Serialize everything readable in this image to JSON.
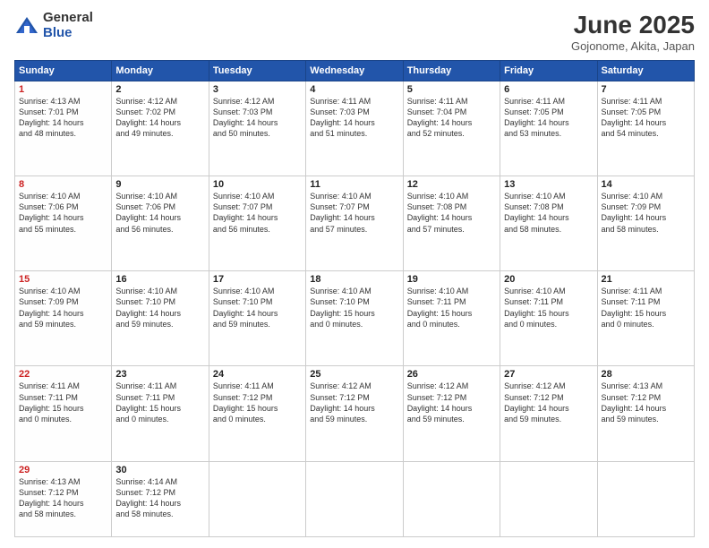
{
  "header": {
    "logo_general": "General",
    "logo_blue": "Blue",
    "month_title": "June 2025",
    "location": "Gojonome, Akita, Japan"
  },
  "weekdays": [
    "Sunday",
    "Monday",
    "Tuesday",
    "Wednesday",
    "Thursday",
    "Friday",
    "Saturday"
  ],
  "weeks": [
    [
      {
        "day": "1",
        "info": "Sunrise: 4:13 AM\nSunset: 7:01 PM\nDaylight: 14 hours\nand 48 minutes."
      },
      {
        "day": "2",
        "info": "Sunrise: 4:12 AM\nSunset: 7:02 PM\nDaylight: 14 hours\nand 49 minutes."
      },
      {
        "day": "3",
        "info": "Sunrise: 4:12 AM\nSunset: 7:03 PM\nDaylight: 14 hours\nand 50 minutes."
      },
      {
        "day": "4",
        "info": "Sunrise: 4:11 AM\nSunset: 7:03 PM\nDaylight: 14 hours\nand 51 minutes."
      },
      {
        "day": "5",
        "info": "Sunrise: 4:11 AM\nSunset: 7:04 PM\nDaylight: 14 hours\nand 52 minutes."
      },
      {
        "day": "6",
        "info": "Sunrise: 4:11 AM\nSunset: 7:05 PM\nDaylight: 14 hours\nand 53 minutes."
      },
      {
        "day": "7",
        "info": "Sunrise: 4:11 AM\nSunset: 7:05 PM\nDaylight: 14 hours\nand 54 minutes."
      }
    ],
    [
      {
        "day": "8",
        "info": "Sunrise: 4:10 AM\nSunset: 7:06 PM\nDaylight: 14 hours\nand 55 minutes."
      },
      {
        "day": "9",
        "info": "Sunrise: 4:10 AM\nSunset: 7:06 PM\nDaylight: 14 hours\nand 56 minutes."
      },
      {
        "day": "10",
        "info": "Sunrise: 4:10 AM\nSunset: 7:07 PM\nDaylight: 14 hours\nand 56 minutes."
      },
      {
        "day": "11",
        "info": "Sunrise: 4:10 AM\nSunset: 7:07 PM\nDaylight: 14 hours\nand 57 minutes."
      },
      {
        "day": "12",
        "info": "Sunrise: 4:10 AM\nSunset: 7:08 PM\nDaylight: 14 hours\nand 57 minutes."
      },
      {
        "day": "13",
        "info": "Sunrise: 4:10 AM\nSunset: 7:08 PM\nDaylight: 14 hours\nand 58 minutes."
      },
      {
        "day": "14",
        "info": "Sunrise: 4:10 AM\nSunset: 7:09 PM\nDaylight: 14 hours\nand 58 minutes."
      }
    ],
    [
      {
        "day": "15",
        "info": "Sunrise: 4:10 AM\nSunset: 7:09 PM\nDaylight: 14 hours\nand 59 minutes."
      },
      {
        "day": "16",
        "info": "Sunrise: 4:10 AM\nSunset: 7:10 PM\nDaylight: 14 hours\nand 59 minutes."
      },
      {
        "day": "17",
        "info": "Sunrise: 4:10 AM\nSunset: 7:10 PM\nDaylight: 14 hours\nand 59 minutes."
      },
      {
        "day": "18",
        "info": "Sunrise: 4:10 AM\nSunset: 7:10 PM\nDaylight: 15 hours\nand 0 minutes."
      },
      {
        "day": "19",
        "info": "Sunrise: 4:10 AM\nSunset: 7:11 PM\nDaylight: 15 hours\nand 0 minutes."
      },
      {
        "day": "20",
        "info": "Sunrise: 4:10 AM\nSunset: 7:11 PM\nDaylight: 15 hours\nand 0 minutes."
      },
      {
        "day": "21",
        "info": "Sunrise: 4:11 AM\nSunset: 7:11 PM\nDaylight: 15 hours\nand 0 minutes."
      }
    ],
    [
      {
        "day": "22",
        "info": "Sunrise: 4:11 AM\nSunset: 7:11 PM\nDaylight: 15 hours\nand 0 minutes."
      },
      {
        "day": "23",
        "info": "Sunrise: 4:11 AM\nSunset: 7:11 PM\nDaylight: 15 hours\nand 0 minutes."
      },
      {
        "day": "24",
        "info": "Sunrise: 4:11 AM\nSunset: 7:12 PM\nDaylight: 15 hours\nand 0 minutes."
      },
      {
        "day": "25",
        "info": "Sunrise: 4:12 AM\nSunset: 7:12 PM\nDaylight: 14 hours\nand 59 minutes."
      },
      {
        "day": "26",
        "info": "Sunrise: 4:12 AM\nSunset: 7:12 PM\nDaylight: 14 hours\nand 59 minutes."
      },
      {
        "day": "27",
        "info": "Sunrise: 4:12 AM\nSunset: 7:12 PM\nDaylight: 14 hours\nand 59 minutes."
      },
      {
        "day": "28",
        "info": "Sunrise: 4:13 AM\nSunset: 7:12 PM\nDaylight: 14 hours\nand 59 minutes."
      }
    ],
    [
      {
        "day": "29",
        "info": "Sunrise: 4:13 AM\nSunset: 7:12 PM\nDaylight: 14 hours\nand 58 minutes."
      },
      {
        "day": "30",
        "info": "Sunrise: 4:14 AM\nSunset: 7:12 PM\nDaylight: 14 hours\nand 58 minutes."
      },
      {
        "day": "",
        "info": ""
      },
      {
        "day": "",
        "info": ""
      },
      {
        "day": "",
        "info": ""
      },
      {
        "day": "",
        "info": ""
      },
      {
        "day": "",
        "info": ""
      }
    ]
  ]
}
